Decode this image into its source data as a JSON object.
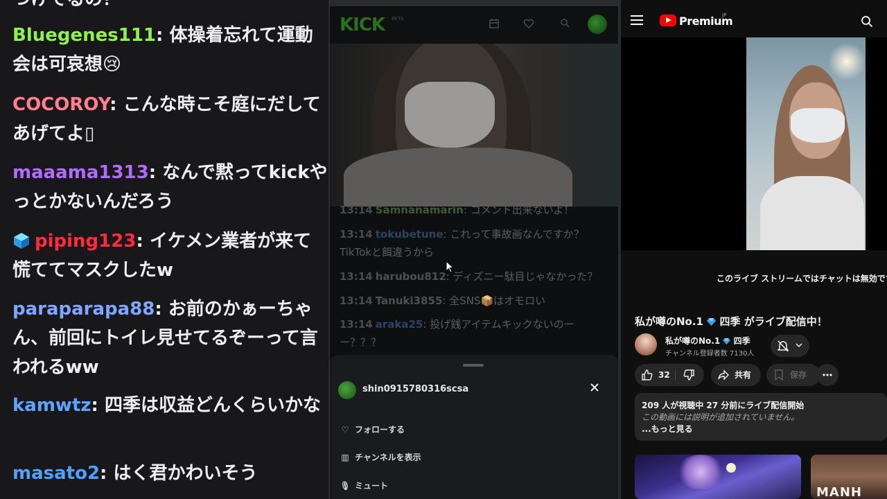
{
  "left_chat": {
    "partial_top": "つけてるの？",
    "messages": [
      {
        "badge": "",
        "user": "Bluegenes111",
        "text": "体操着忘れて運動会は可哀想😢",
        "color": "#8ef24a"
      },
      {
        "badge": "",
        "user": "COCOROY",
        "text": "こんな時こそ庭にだしてあげてよ▯",
        "color": "#ff7f8f"
      },
      {
        "badge": "",
        "user": "maaama1313",
        "text": "なんで黙ってkickやっとかないんだろう",
        "color": "#b469ff"
      },
      {
        "badge": "cube-badge-icon",
        "user": "piping123",
        "text": "イケメン業者が来て慌ててマスクしたw",
        "color": "#ff2a3a"
      },
      {
        "badge": "",
        "user": "paraparapa88",
        "text": "お前のかぁーちゃん、前回にトイレ見せてるぞーって言われるww",
        "color": "#7fa7ff"
      },
      {
        "badge": "",
        "user": "kamwtz",
        "text": "四季は収益どんくらいかな",
        "color": "#5aa6ff"
      },
      {
        "badge": "",
        "user": "masato2",
        "text": "はく君かわいそう",
        "color": "#4ea1ff"
      }
    ]
  },
  "kick": {
    "logo": "KICK",
    "beta": "BETA",
    "messages": [
      {
        "time": "13:14",
        "user": "Samnanamarin",
        "text": "コメント出来ないよ！",
        "user_color": "#3e5a36"
      },
      {
        "time": "13:14",
        "user": "tokubetune",
        "text": "これって事故画なんですか？TikTokと餌違うから",
        "user_color": "#2a4560"
      },
      {
        "time": "13:14",
        "user": "harubou812",
        "text": "ディズニー駄目じゃなかった？",
        "user_color": "#4e4f52"
      },
      {
        "time": "13:14",
        "user": "Tanuki3855",
        "text": "全SNS📦はオモロい",
        "user_color": "#4e4f52"
      },
      {
        "time": "13:14",
        "user": "araka25",
        "text": "投げ銭アイテムキックないのーー？？？",
        "user_color": "#2a4560"
      }
    ],
    "sheet": {
      "username": "shin0915780316scsa",
      "items": [
        "フォローする",
        "チャンネルを表示",
        "ミュート"
      ]
    }
  },
  "youtube": {
    "brand": "Premium",
    "region": "JP",
    "chat_disabled": "このライブ ストリームではチャットは無効です",
    "title_a": "私が噂のNo.1",
    "title_b": "四季 がライブ配信中！",
    "channel_a": "私が噂のNo.1",
    "channel_b": "四季",
    "subscribers": "チャンネル登録者数 7130人",
    "likes": "32",
    "share": "共有",
    "save": "保存",
    "desc_line1": "209 人が視聴中  27 分前にライブ配信開始",
    "desc_line2": "この動画には説明が追加されていません。",
    "desc_line3": "...もっと見る",
    "thumb2_text": "MANH"
  }
}
